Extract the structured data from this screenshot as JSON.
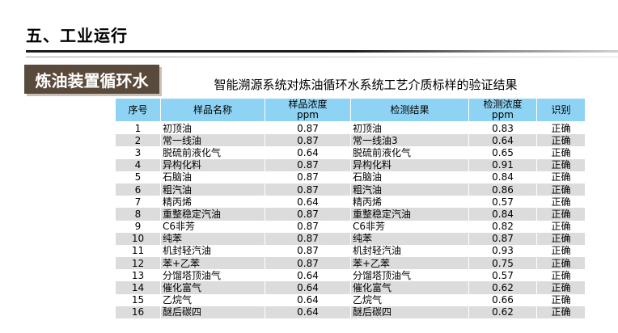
{
  "section": {
    "title": "五、工业运行"
  },
  "tag": {
    "label": "炼油装置循环水"
  },
  "table": {
    "caption": "智能溯源系统对炼油循环水系统工艺介质标样的验证结果",
    "headers": {
      "seq": "序号",
      "name": "样品名称",
      "conc_line1": "样品浓度",
      "conc_line2": "ppm",
      "result": "检测结果",
      "det_line1": "检测浓度",
      "det_line2": "ppm",
      "ident": "识别"
    },
    "rows": [
      {
        "seq": "1",
        "name": "初顶油",
        "conc": "0.87",
        "result": "初顶油",
        "det": "0.83",
        "ident": "正确"
      },
      {
        "seq": "2",
        "name": "常一线油",
        "conc": "0.87",
        "result": "常一线油3",
        "det": "0.64",
        "ident": "正确"
      },
      {
        "seq": "3",
        "name": "脱硫前液化气",
        "conc": "0.64",
        "result": "脱硫前液化气",
        "det": "0.65",
        "ident": "正确"
      },
      {
        "seq": "4",
        "name": "异构化料",
        "conc": "0.87",
        "result": "异构化料",
        "det": "0.91",
        "ident": "正确"
      },
      {
        "seq": "5",
        "name": "石脑油",
        "conc": "0.87",
        "result": "石脑油",
        "det": "0.84",
        "ident": "正确"
      },
      {
        "seq": "6",
        "name": "粗汽油",
        "conc": "0.87",
        "result": "粗汽油",
        "det": "0.86",
        "ident": "正确"
      },
      {
        "seq": "7",
        "name": "精丙烯",
        "conc": "0.64",
        "result": "精丙烯",
        "det": "0.57",
        "ident": "正确"
      },
      {
        "seq": "8",
        "name": "重整稳定汽油",
        "conc": "0.87",
        "result": "重整稳定汽油",
        "det": "0.84",
        "ident": "正确"
      },
      {
        "seq": "9",
        "name": "C6非芳",
        "conc": "0.87",
        "result": "C6非芳",
        "det": "0.82",
        "ident": "正确"
      },
      {
        "seq": "10",
        "name": "纯苯",
        "conc": "0.87",
        "result": "纯苯",
        "det": "0.87",
        "ident": "正确"
      },
      {
        "seq": "11",
        "name": "机封轻汽油",
        "conc": "0.87",
        "result": "机封轻汽油",
        "det": "0.93",
        "ident": "正确"
      },
      {
        "seq": "12",
        "name": "苯+乙苯",
        "conc": "0.87",
        "result": "苯+乙苯",
        "det": "0.75",
        "ident": "正确"
      },
      {
        "seq": "13",
        "name": "分馏塔顶油气",
        "conc": "0.64",
        "result": "分馏塔顶油气",
        "det": "0.57",
        "ident": "正确"
      },
      {
        "seq": "14",
        "name": "催化富气",
        "conc": "0.64",
        "result": "催化富气",
        "det": "0.62",
        "ident": "正确"
      },
      {
        "seq": "15",
        "name": "乙烷气",
        "conc": "0.64",
        "result": "乙烷气",
        "det": "0.66",
        "ident": "正确"
      },
      {
        "seq": "16",
        "name": "醚后碳四",
        "conc": "0.64",
        "result": "醚后碳四",
        "det": "0.62",
        "ident": "正确"
      }
    ]
  }
}
